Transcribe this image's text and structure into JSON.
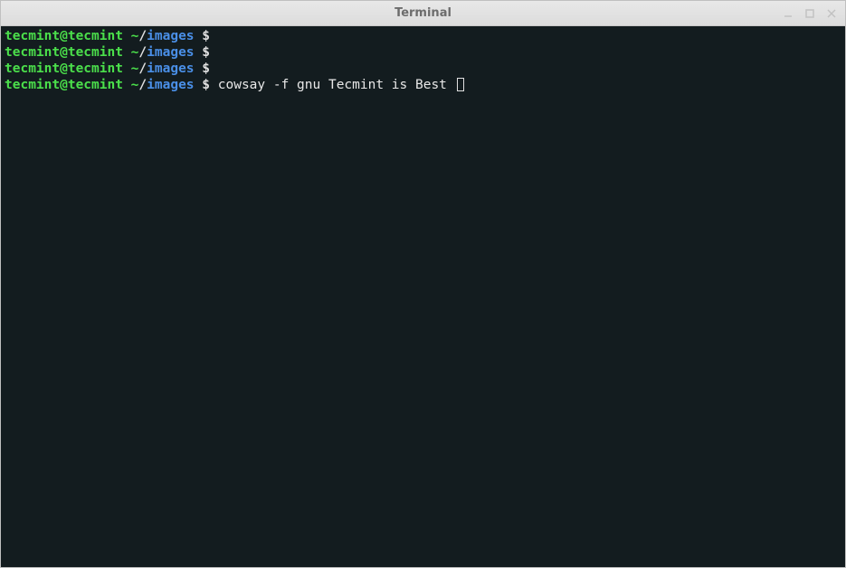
{
  "titlebar": {
    "title": "Terminal"
  },
  "prompt": {
    "user_host": "tecmint@tecmint",
    "tilde": " ~",
    "slash": "/",
    "dir": "images",
    "dollar": " $ "
  },
  "lines": [
    {
      "command": ""
    },
    {
      "command": ""
    },
    {
      "command": ""
    },
    {
      "command": "cowsay -f gnu Tecmint is Best ",
      "cursor": true
    }
  ]
}
